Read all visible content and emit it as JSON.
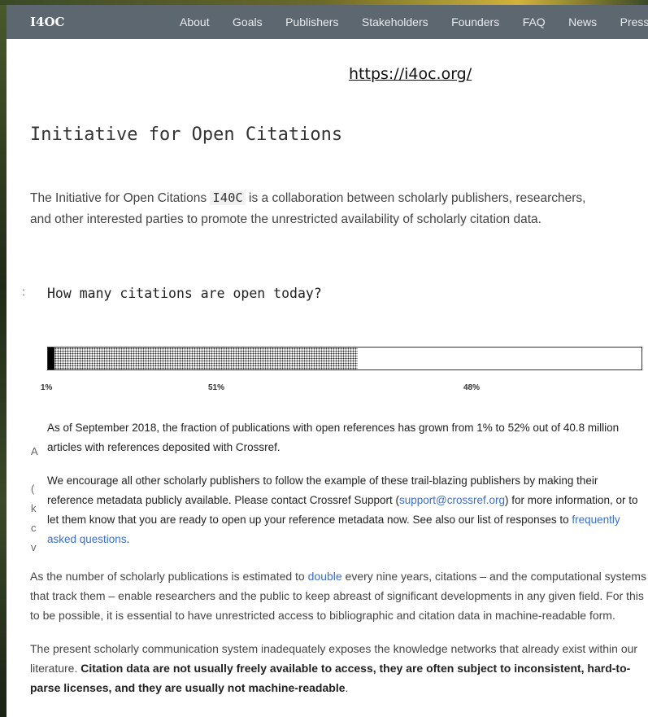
{
  "nav": {
    "brand": "I4OC",
    "links": [
      "About",
      "Goals",
      "Publishers",
      "Stakeholders",
      "Founders",
      "FAQ",
      "News",
      "Press"
    ]
  },
  "url_caption": "https://i4oc.org/",
  "page_title": "Initiative for Open Citations",
  "intro": {
    "before": "The Initiative for Open Citations ",
    "code": "I40C",
    "after": " is a collaboration between scholarly publishers, researchers, and other interested parties to promote the unrestricted availability of scholarly citation data."
  },
  "question": "How many citations are open today?",
  "progress": {
    "closed_fraction": 0.01,
    "open_fraction": 0.51,
    "remaining_fraction": 0.48,
    "labels": [
      "1%",
      "51%",
      "48%"
    ]
  },
  "note1": "As of September 2018, the fraction of publications with open references has grown from 1% to 52% out of 40.8 million articles with references deposited with Crossref.",
  "note2": {
    "before": "We encourage all other scholarly publishers to follow the example of these trail-blazing publishers by making their reference metadata publicly available. Please contact Crossref Support (",
    "email": "support@crossref.org",
    "middle": ") for more information, or to let them know that you are ready to open up your reference metadata now. See also our list of responses to ",
    "faq_link": "frequently asked questions",
    "after": "."
  },
  "para1": {
    "before": "As the number of scholarly publications is estimated to ",
    "link": "double",
    "after": " every nine years, citations – and the computational systems that track them – enable researchers and the public to keep abreast of significant developments in any given field. For this to be possible, it is essential to have unrestricted access to bibliographic and citation data in machine-readable form."
  },
  "para2": {
    "before": "The present scholarly communication system inadequately exposes the knowledge networks that already exist within our literature. ",
    "bold": "Citation data are not usually freely available to access, they are often subject to inconsistent, hard-to-parse licenses, and they are usually not machine-readable",
    "after": "."
  },
  "ghost_letters": [
    ":",
    "A",
    "(",
    "k",
    "c",
    "v"
  ],
  "colors": {
    "nav_bg": "#5d6770",
    "link": "#3a6fc4"
  }
}
